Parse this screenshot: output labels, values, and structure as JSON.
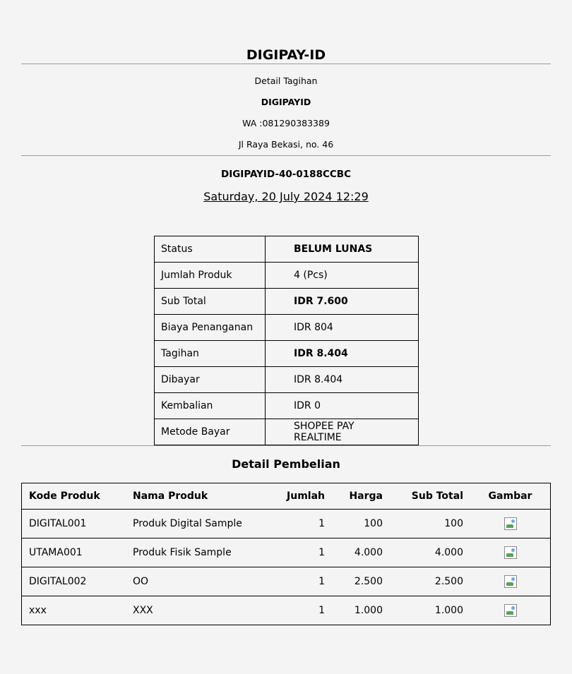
{
  "header": {
    "brand": "DIGIPAY-ID"
  },
  "merchant": {
    "caption": "Detail Tagihan",
    "name": "DIGIPAYID",
    "whatsapp": "WA :081290383389",
    "address": "Jl Raya Bekasi, no. 46"
  },
  "invoice": {
    "id": "DIGIPAYID-40-0188CCBC",
    "date": "Saturday, 20 July 2024 12:29"
  },
  "summary": [
    {
      "label": "Status",
      "value": "BELUM LUNAS",
      "bold": true
    },
    {
      "label": "Jumlah Produk",
      "value": "4 (Pcs)",
      "bold": false
    },
    {
      "label": "Sub Total",
      "value": "IDR 7.600",
      "bold": true
    },
    {
      "label": "Biaya Penanganan",
      "value": "IDR 804",
      "bold": false
    },
    {
      "label": "Tagihan",
      "value": "IDR 8.404",
      "bold": true
    },
    {
      "label": "Dibayar",
      "value": "IDR 8.404",
      "bold": false
    },
    {
      "label": "Kembalian",
      "value": "IDR 0",
      "bold": false
    },
    {
      "label": "Metode Bayar",
      "value": "SHOPEE PAY REALTIME",
      "bold": false
    }
  ],
  "purchase": {
    "title": "Detail Pembelian",
    "columns": [
      "Kode Produk",
      "Nama Produk",
      "Jumlah",
      "Harga",
      "Sub Total",
      "Gambar"
    ],
    "rows": [
      {
        "code": "DIGITAL001",
        "name": "Produk Digital Sample",
        "qty": "1",
        "price": "100",
        "subtotal": "100",
        "image": "broken-image-icon"
      },
      {
        "code": "UTAMA001",
        "name": "Produk Fisik Sample",
        "qty": "1",
        "price": "4.000",
        "subtotal": "4.000",
        "image": "broken-image-icon"
      },
      {
        "code": "DIGITAL002",
        "name": "OO",
        "qty": "1",
        "price": "2.500",
        "subtotal": "2.500",
        "image": "broken-image-icon"
      },
      {
        "code": "xxx",
        "name": "XXX",
        "qty": "1",
        "price": "1.000",
        "subtotal": "1.000",
        "image": "broken-image-icon"
      }
    ]
  }
}
